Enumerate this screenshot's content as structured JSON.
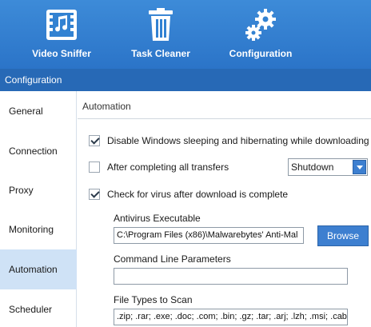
{
  "toolbar": {
    "video_sniffer": "Video Sniffer",
    "task_cleaner": "Task Cleaner",
    "configuration": "Configuration"
  },
  "section_title": "Configuration",
  "sidebar": {
    "items": [
      {
        "label": "General"
      },
      {
        "label": "Connection"
      },
      {
        "label": "Proxy"
      },
      {
        "label": "Monitoring"
      },
      {
        "label": "Automation"
      },
      {
        "label": "Scheduler"
      }
    ],
    "active": "Automation"
  },
  "automation": {
    "title": "Automation",
    "disable_sleep": {
      "label": "Disable Windows sleeping and hibernating while downloading",
      "checked": true
    },
    "after_complete": {
      "label": "After completing all transfers",
      "checked": false
    },
    "after_action": "Shutdown",
    "virus_check": {
      "label": "Check for virus after download is complete",
      "checked": true
    },
    "antivirus_label": "Antivirus Executable",
    "antivirus_value": "C:\\Program Files (x86)\\Malwarebytes' Anti-Mal",
    "browse_label": "Browse",
    "cmdline_label": "Command Line Parameters",
    "cmdline_value": "",
    "filetypes_label": "File Types to Scan",
    "filetypes_value": ".zip; .rar; .exe; .doc; .com; .bin; .gz; .tar; .arj; .lzh; .msi; .cab;"
  },
  "colors": {
    "toolbar": "#3282d2",
    "section_bar": "#2769b6",
    "active_item": "#cfe2f6",
    "accent_button": "#3d7fd0"
  }
}
